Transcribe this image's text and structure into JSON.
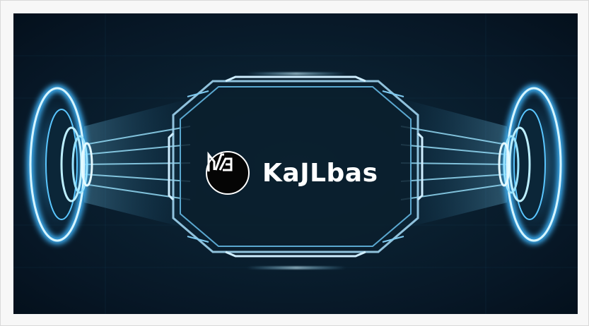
{
  "banner": {
    "brand_name": "KaJLbas",
    "logo_icon": "kajlbas-logo-icon",
    "colors": {
      "background": "#071726",
      "glow": "#3fb8ff",
      "frame": "#9fd4f0",
      "text": "#ffffff"
    }
  }
}
